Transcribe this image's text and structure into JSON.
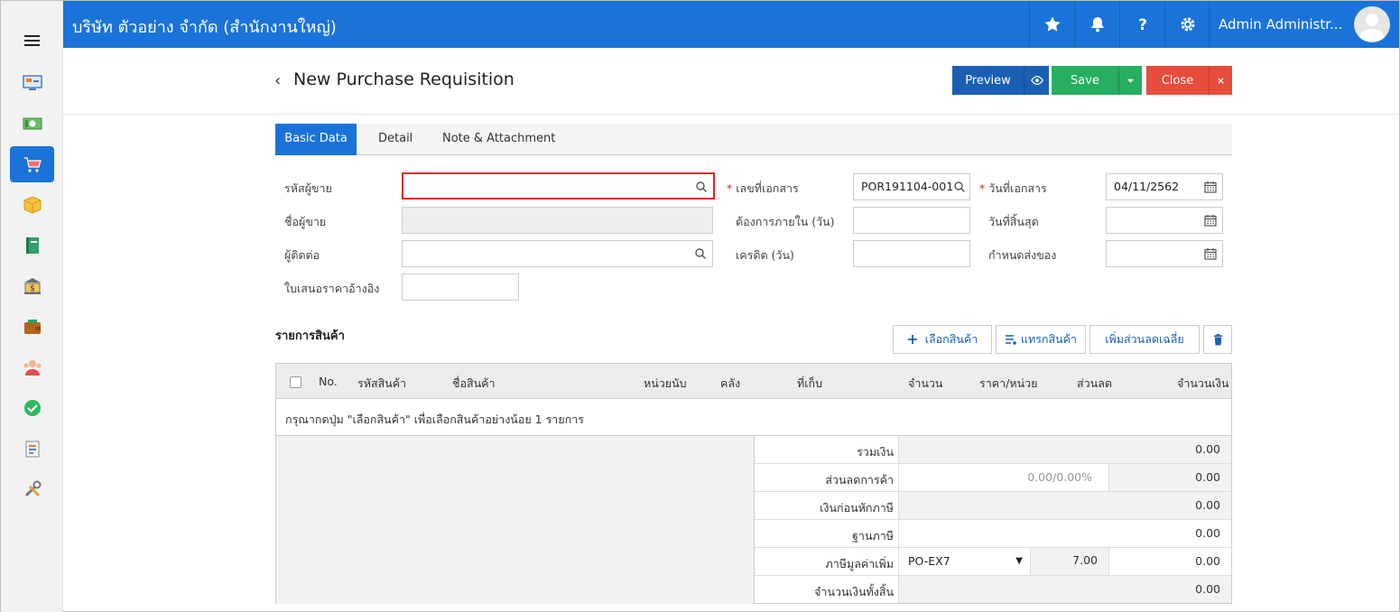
{
  "topbar": {
    "company": "บริษัท ตัวอย่าง จำกัด (สำนักงานใหญ่)",
    "user_name": "Admin Administr..."
  },
  "header": {
    "title": "New Purchase Requisition",
    "preview_label": "Preview",
    "save_label": "Save",
    "close_label": "Close"
  },
  "tabs": [
    {
      "label": "Basic Data"
    },
    {
      "label": "Detail"
    },
    {
      "label": "Note & Attachment"
    }
  ],
  "form": {
    "vendor_code_label": "รหัสผู้ขาย",
    "vendor_name_label": "ชื่อผู้ขาย",
    "contact_label": "ผู้ติดต่อ",
    "quote_ref_label": "ใบเสนอราคาอ้างอิง",
    "doc_no_label": "เลขที่เอกสาร",
    "doc_no_value": "POR191104-001",
    "needed_within_label": "ต้องการภายใน (วัน)",
    "credit_label": "เครดิต (วัน)",
    "doc_date_label": "วันที่เอกสาร",
    "doc_date_value": "04/11/2562",
    "end_date_label": "วันที่สิ้นสุด",
    "delivery_label": "กำหนดส่งของ"
  },
  "items": {
    "title": "รายการสินค้า",
    "select_btn": "เลือกสินค้า",
    "insert_btn": "แทรกสินค้า",
    "avg_discount_btn": "เพิ่มส่วนลดเฉลี่ย",
    "columns": [
      "No.",
      "รหัสสินค้า",
      "ชื่อสินค้า",
      "หน่วยนับ",
      "คลัง",
      "ที่เก็บ",
      "จำนวน",
      "ราคา/หน่วย",
      "ส่วนลด",
      "จำนวนเงิน"
    ],
    "empty_message": "กรุณากดปุ่ม \"เลือกสินค้า\" เพื่อเลือกสินค้าอย่างน้อย 1 รายการ"
  },
  "summary": {
    "total_label": "รวมเงิน",
    "total_value": "0.00",
    "discount_label": "ส่วนลดการค้า",
    "discount_input": "0.00/0.00%",
    "discount_value": "0.00",
    "before_tax_label": "เงินก่อนหักภาษี",
    "before_tax_value": "0.00",
    "tax_base_label": "ฐานภาษี",
    "tax_base_value": "0.00",
    "vat_label": "ภาษีมูลค่าเพิ่ม",
    "vat_code": "PO-EX7",
    "vat_rate": "7.00",
    "vat_value": "0.00",
    "grand_total_label": "จำนวนเงินทั้งสิ้น",
    "grand_total_value": "0.00"
  },
  "colors": {
    "primary": "#1a73d8",
    "save": "#27ae60",
    "close": "#e74c3c",
    "preview": "#1a5fb4"
  }
}
